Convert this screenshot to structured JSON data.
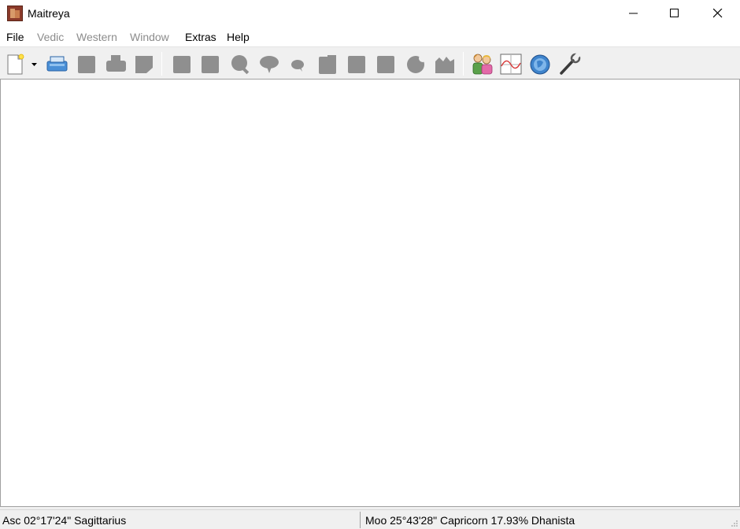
{
  "window": {
    "title": "Maitreya"
  },
  "menu": {
    "items": [
      {
        "label": "File",
        "enabled": true
      },
      {
        "label": "Vedic",
        "enabled": false
      },
      {
        "label": "Western",
        "enabled": false
      },
      {
        "label": "Window",
        "enabled": false
      },
      {
        "label": "Extras",
        "enabled": true
      },
      {
        "label": "Help",
        "enabled": true
      }
    ]
  },
  "toolbar": {
    "icons": [
      "new-document-icon",
      "dropdown-arrow-icon",
      "open-icon",
      "save-icon",
      "print-icon",
      "save-as-icon",
      "chart-icon",
      "chart-2-icon",
      "search-icon",
      "chat-icon",
      "small-chat-icon",
      "table-icon",
      "grid-icon",
      "grid-2-icon",
      "moon-icon",
      "building-icon",
      "partner-chart-icon",
      "graph-icon",
      "globe-icon",
      "configuration-wrench-icon"
    ]
  },
  "status": {
    "left": "Asc 02°17'24\" Sagittarius",
    "right": "Moo 25°43'28\" Capricorn 17.93% Dhanista"
  },
  "colors": {
    "disabled_text": "#8c8c8c",
    "disabled_icon": "#8f8f8f",
    "client_bg": "#ffffff",
    "chrome_bg": "#f0f0f0"
  }
}
